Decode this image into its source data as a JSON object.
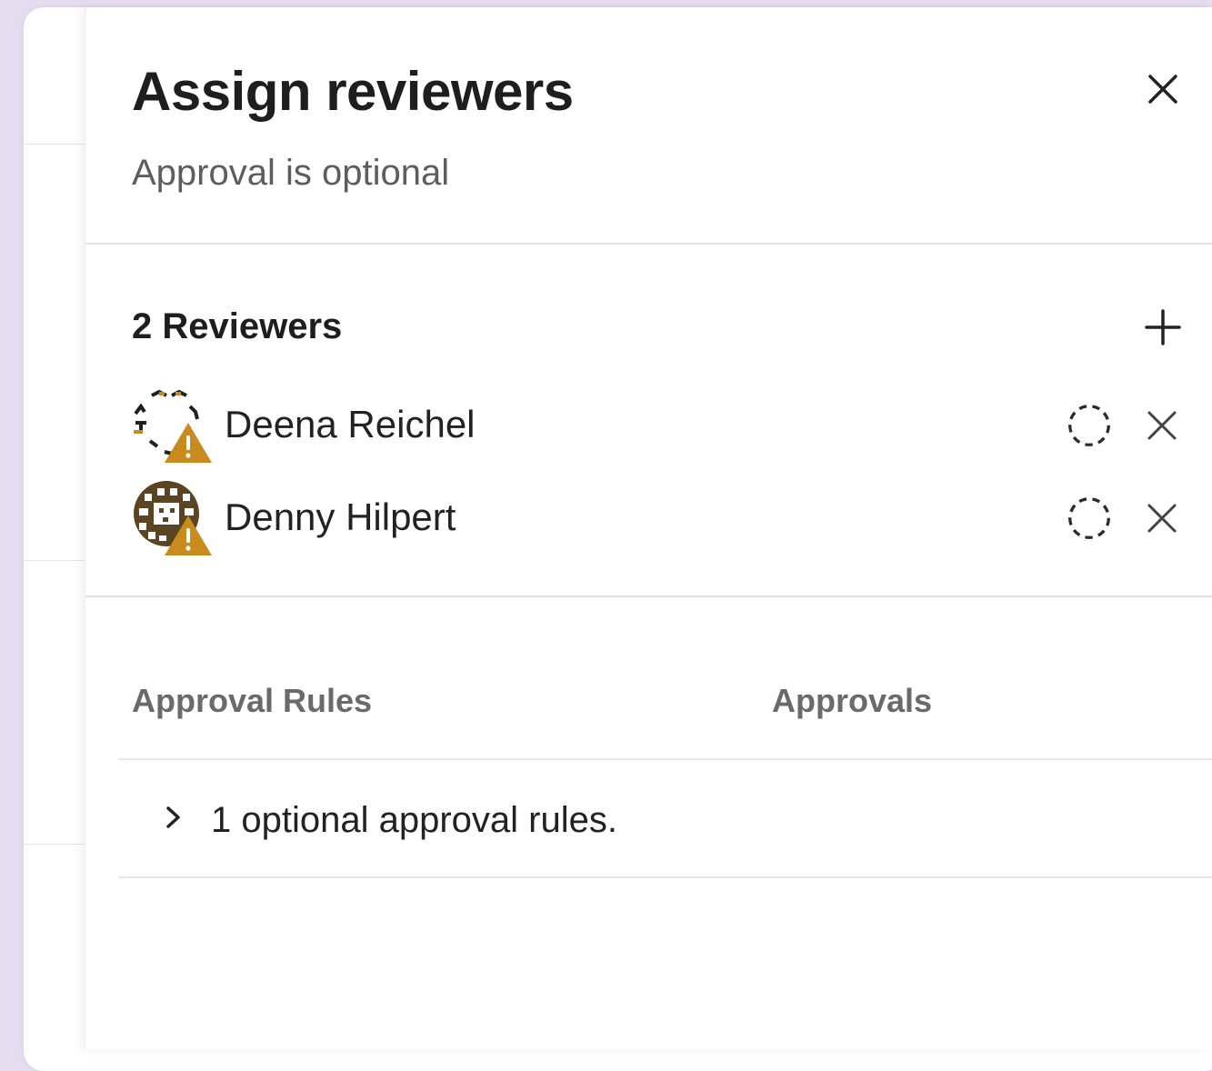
{
  "drawer": {
    "title": "Assign reviewers",
    "subtitle": "Approval is optional"
  },
  "reviewers": {
    "heading": "2 Reviewers",
    "items": [
      {
        "name": "Deena Reichel",
        "avatar_icon": "identicon-avatar-warning-icon",
        "status_icon": "pending-status-icon"
      },
      {
        "name": "Denny Hilpert",
        "avatar_icon": "identicon-avatar-warning-icon",
        "status_icon": "pending-status-icon"
      }
    ]
  },
  "approval_rules": {
    "columns": [
      "Approval Rules",
      "Approvals"
    ],
    "rows": [
      {
        "text": "1 optional approval rules."
      }
    ]
  },
  "colors": {
    "page_background": "#e4dcef",
    "warning": "#c98a1e",
    "avatar_brown": "#5a4421"
  }
}
